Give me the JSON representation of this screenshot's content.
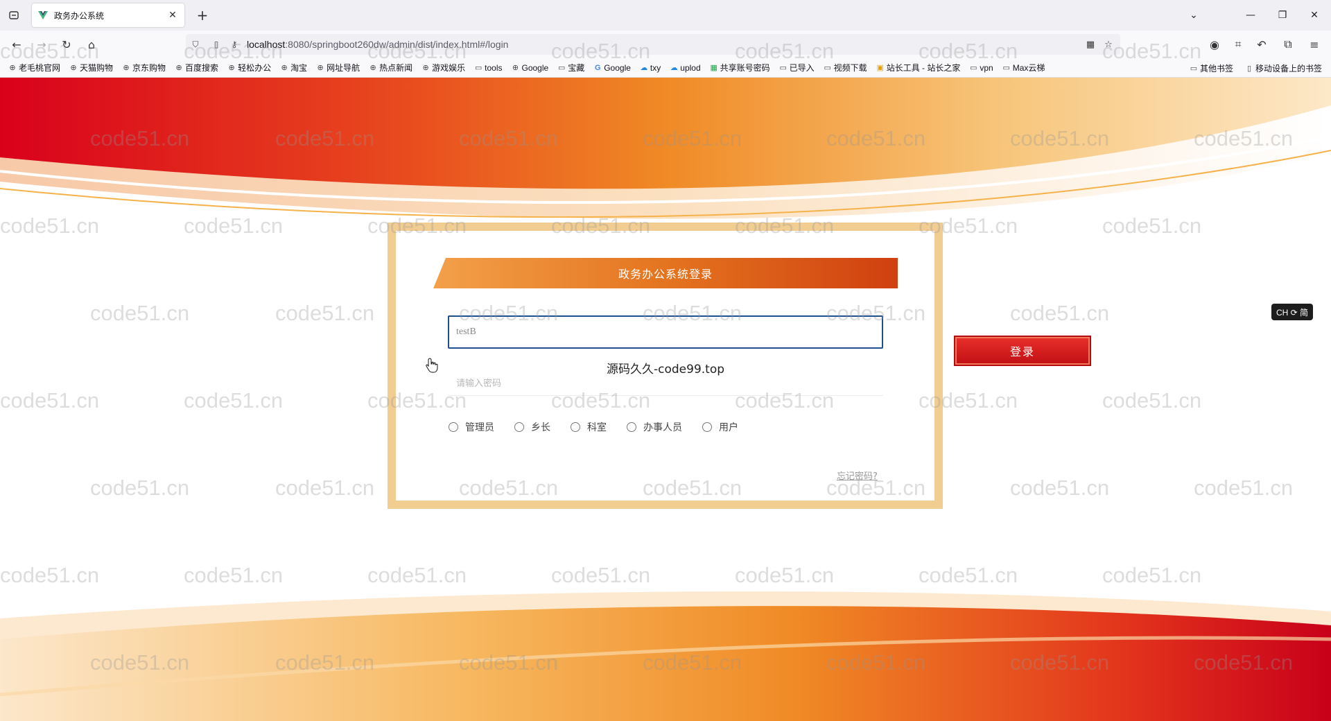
{
  "browser": {
    "tab_title": "政务办公系统",
    "url_host": "localhost",
    "url_rest": ":8080/springboot260dw/admin/dist/index.html#/login",
    "bookmarks": [
      "老毛桃官网",
      "天猫购物",
      "京东购物",
      "百度搜索",
      "轻松办公",
      "淘宝",
      "网址导航",
      "热点新闻",
      "游戏娱乐",
      "tools",
      "Google",
      "宝藏",
      "Google",
      "txy",
      "uplod",
      "共享账号密码",
      "已导入",
      "视频下载",
      "站长工具 - 站长之家",
      "vpn",
      "Max云梯"
    ],
    "bookmarks_right": [
      "其他书签",
      "移动设备上的书签"
    ]
  },
  "login": {
    "title": "政务办公系统登录",
    "username_value": "testB",
    "password_placeholder": "请输入密码",
    "roles": [
      "管理员",
      "乡长",
      "科室",
      "办事人员",
      "用户"
    ],
    "forgot": "忘记密码?",
    "login_button": "登录",
    "overlay_text": "源码久久-code99.top"
  },
  "ime": "CH ⟳ 简",
  "watermark": "code51.cn"
}
